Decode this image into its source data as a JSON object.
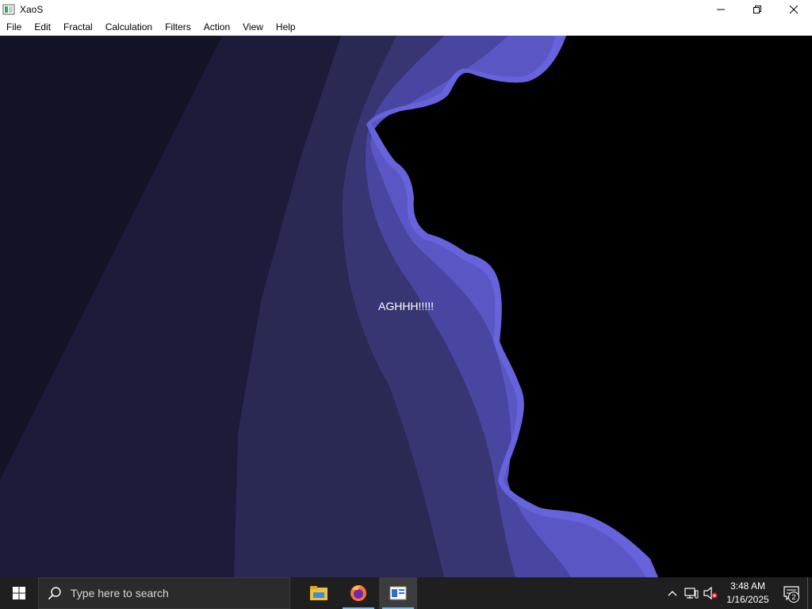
{
  "window": {
    "title": "XaoS",
    "controls": [
      "minimize",
      "restore",
      "close"
    ]
  },
  "menu": {
    "items": [
      "File",
      "Edit",
      "Fractal",
      "Calculation",
      "Filters",
      "Action",
      "View",
      "Help"
    ]
  },
  "canvas": {
    "message": "AGHHH!!!!!",
    "colors": {
      "background": "#000000",
      "band1": "#15152a",
      "band2": "#1e1e3c",
      "band3": "#2b2a55",
      "band4": "#3b3a78",
      "band5": "#4a48a0",
      "band6": "#5652c0",
      "band7": "#6461d8"
    }
  },
  "taskbar": {
    "search_placeholder": "Type here to search",
    "apps": [
      {
        "name": "file-explorer-icon",
        "active": false
      },
      {
        "name": "firefox-icon",
        "active": false
      },
      {
        "name": "xaos-app-icon",
        "active": true
      }
    ],
    "clock": {
      "time": "3:48 AM",
      "date": "1/16/2025"
    },
    "notification_count": "2",
    "accent": "#76b9ed"
  }
}
